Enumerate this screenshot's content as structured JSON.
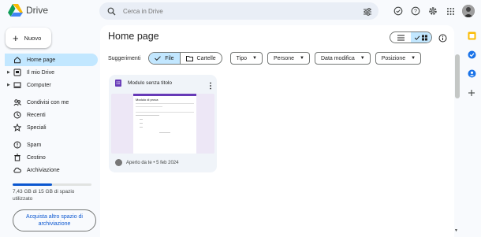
{
  "app": {
    "name": "Drive"
  },
  "search": {
    "placeholder": "Cerca in Drive"
  },
  "new_button": {
    "label": "Nuovo"
  },
  "nav": {
    "items": [
      {
        "label": "Home page",
        "icon": "home-icon"
      },
      {
        "label": "Il mio Drive",
        "icon": "my-drive-icon"
      },
      {
        "label": "Computer",
        "icon": "computer-icon"
      },
      {
        "label": "Condivisi con me",
        "icon": "shared-icon"
      },
      {
        "label": "Recenti",
        "icon": "clock-icon"
      },
      {
        "label": "Speciali",
        "icon": "star-icon"
      },
      {
        "label": "Spam",
        "icon": "spam-icon"
      },
      {
        "label": "Cestino",
        "icon": "trash-icon"
      },
      {
        "label": "Archiviazione",
        "icon": "cloud-icon"
      }
    ]
  },
  "storage": {
    "text": "7,43 GB di 15 GB di spazio utilizzato",
    "used_fraction": 0.495,
    "buy_label": "Acquista altro spazio di archiviazione"
  },
  "main": {
    "title": "Home page",
    "suggestions_label": "Suggerimenti",
    "segments": [
      "File",
      "Cartelle"
    ],
    "filters": [
      "Tipo",
      "Persone",
      "Data modifica",
      "Posizione"
    ]
  },
  "card": {
    "title": "Modulo senza titolo",
    "footer": "Aperto da te • 5 feb 2024",
    "thumb_title": "Modulo di prova"
  },
  "colors": {
    "accent": "#c2e7ff",
    "brand_blue": "#0b57d0",
    "form_purple": "#673ab7"
  }
}
